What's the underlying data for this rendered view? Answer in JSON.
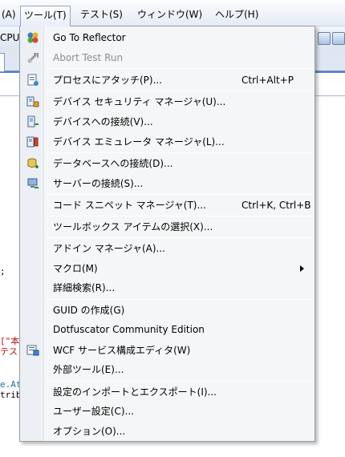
{
  "menubar": {
    "items": [
      {
        "label": "(A)"
      },
      {
        "label": "ツール(T)"
      },
      {
        "label": "テスト(S)"
      },
      {
        "label": "ウィンドウ(W)"
      },
      {
        "label": "ヘルプ(H)"
      }
    ]
  },
  "toolbar": {
    "cpu_label": "CPU"
  },
  "code": {
    "line1": ";",
    "line2": "[\"本",
    "line3": "テス",
    "line4": "e.At",
    "line5": "trib"
  },
  "menu": {
    "items": [
      {
        "label": "Go To Reflector",
        "icon": "reflector-icon"
      },
      {
        "label": "Abort Test Run",
        "icon": "abort-test-run-icon",
        "disabled": true
      },
      {
        "label": "プロセスにアタッチ(P)...",
        "shortcut": "Ctrl+Alt+P",
        "icon": "attach-process-icon"
      },
      {
        "label": "デバイス セキュリティ マネージャ(U)...",
        "icon": "device-security-icon"
      },
      {
        "label": "デバイスへの接続(V)...",
        "icon": "device-connect-icon"
      },
      {
        "label": "デバイス エミュレータ マネージャ(L)...",
        "icon": "device-emulator-icon"
      },
      {
        "label": "データベースへの接続(D)...",
        "icon": "database-connect-icon"
      },
      {
        "label": "サーバーの接続(S)...",
        "icon": "server-connect-icon"
      },
      {
        "label": "コード スニペット マネージャ(T)...",
        "shortcut": "Ctrl+K, Ctrl+B"
      },
      {
        "label": "ツールボックス アイテムの選択(X)..."
      },
      {
        "label": "アドイン マネージャ(A)..."
      },
      {
        "label": "マクロ(M)"
      },
      {
        "label": "詳細検索(R)..."
      },
      {
        "label": "GUID の作成(G)"
      },
      {
        "label": "Dotfuscator Community Edition"
      },
      {
        "label": "WCF サービス構成エディタ(W)",
        "icon": "wcf-config-icon"
      },
      {
        "label": "外部ツール(E)..."
      },
      {
        "label": "設定のインポートとエクスポート(I)..."
      },
      {
        "label": "ユーザー設定(C)..."
      },
      {
        "label": "オプション(O)..."
      }
    ]
  },
  "colors": {
    "accent": "#5f86c0",
    "menu_bg": "#f5f6f7",
    "disabled_text": "#8d8d8d"
  }
}
